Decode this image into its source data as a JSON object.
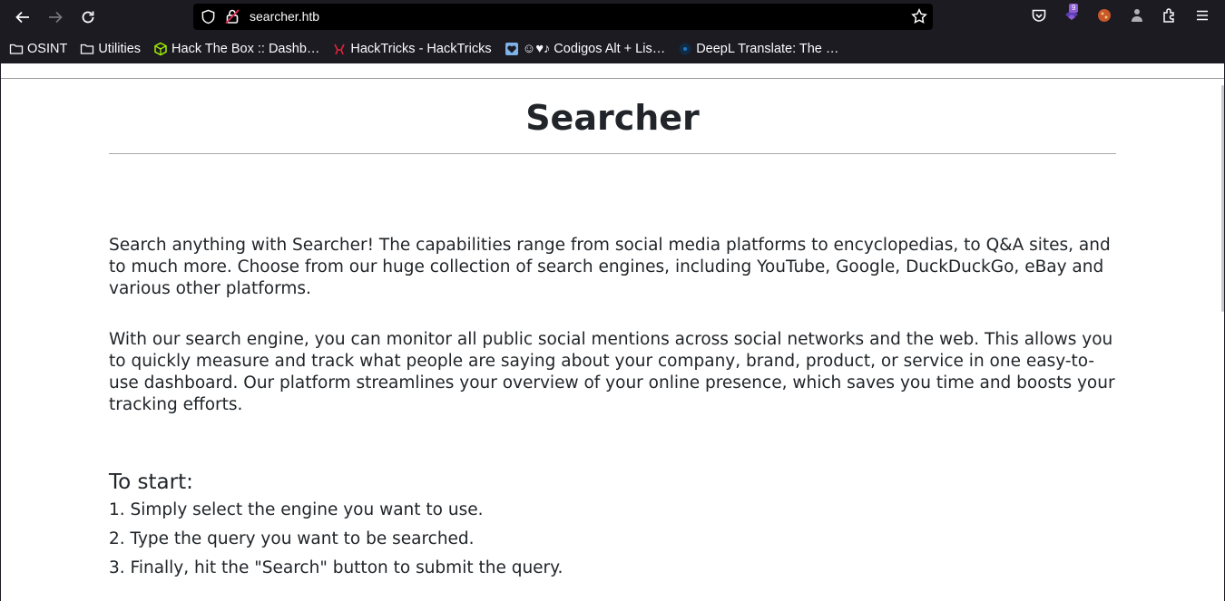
{
  "browser": {
    "url": "searcher.htb",
    "extension_badge": "9",
    "bookmarks": [
      {
        "label": "OSINT",
        "icon": "folder-icon"
      },
      {
        "label": "Utilities",
        "icon": "folder-icon"
      },
      {
        "label": "Hack The Box :: Dashb…",
        "icon": "htb-cube-icon"
      },
      {
        "label": "HackTricks - HackTricks",
        "icon": "hacktricks-icon"
      },
      {
        "label": "☺♥♪ Codigos Alt + Lis…",
        "icon": "heart-icon"
      },
      {
        "label": "DeepL Translate: The …",
        "icon": "deepl-icon"
      }
    ]
  },
  "page": {
    "title": "Searcher",
    "intro": "Search anything with Searcher! The capabilities range from social media platforms to encyclopedias, to Q&A sites, and to much more. Choose from our huge collection of search engines, including YouTube, Google, DuckDuckGo, eBay and various other platforms.",
    "description": "With our search engine, you can monitor all public social mentions across social networks and the web. This allows you to quickly measure and track what people are saying about your company, brand, product, or service in one easy-to-use dashboard. Our platform streamlines your overview of your online presence, which saves you time and boosts your tracking efforts.",
    "start_heading": "To start:",
    "steps": [
      "1. Simply select the engine you want to use.",
      "2. Type the query you want to be searched.",
      "3. Finally, hit the \"Search\" button to submit the query."
    ]
  }
}
